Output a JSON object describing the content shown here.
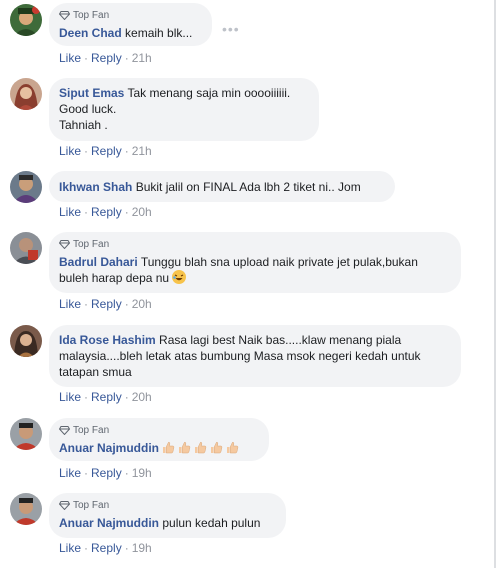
{
  "badge_label": "Top Fan",
  "like_label": "Like",
  "reply_label": "Reply",
  "separator": "·",
  "comments": [
    {
      "name": "Deen Chad",
      "text": "kemaih blk...",
      "time": "21h",
      "badge": true
    },
    {
      "name": "Siput Emas",
      "text_lines": [
        "Tak menang saja min ooooiiiiii.",
        "Good luck.",
        "Tahniah ."
      ],
      "time": "21h",
      "badge": false
    },
    {
      "name": "Ikhwan Shah",
      "text": "Bukit jalil on FINAL Ada lbh 2 tiket ni.. Jom",
      "time": "20h",
      "badge": false
    },
    {
      "name": "Badrul Dahari",
      "text_lines": [
        "Tunggu blah sna upload naik private jet pulak,bukan",
        "buleh harap depa nu"
      ],
      "time": "20h",
      "badge": true
    },
    {
      "name": "Ida Rose Hashim",
      "text_lines": [
        "Rasa lagi best Naik bas.....klaw menang piala",
        "malaysia....bleh letak atas bumbung Masa msok negeri kedah untuk",
        "tatapan smua"
      ],
      "time": "20h",
      "badge": false
    },
    {
      "name": "Anuar Najmuddin",
      "text": "",
      "thumbs_count": 5,
      "time": "19h",
      "badge": true
    },
    {
      "name": "Anuar Najmuddin",
      "text": "pulun kedah pulun",
      "time": "19h",
      "badge": true
    }
  ],
  "colors": {
    "name": "#385898",
    "bubble": "#f2f3f5",
    "meta": "#90949c",
    "emoji": "#f7c34b",
    "thumb": "#f5c9a0"
  }
}
